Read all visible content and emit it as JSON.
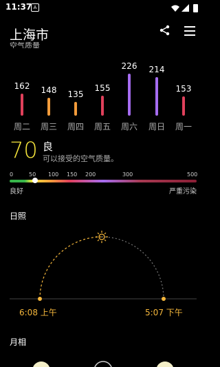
{
  "status": {
    "time": "11:37",
    "notif_icon": "A"
  },
  "header": {
    "city": "上海市",
    "aqi_section": "空气质量"
  },
  "aqi_days": [
    {
      "day": "周二",
      "value": 162,
      "color": "#e0405b"
    },
    {
      "day": "周三",
      "value": 148,
      "color": "#f29b3b"
    },
    {
      "day": "周四",
      "value": 135,
      "color": "#f29b3b"
    },
    {
      "day": "周五",
      "value": 155,
      "color": "#e0405b"
    },
    {
      "day": "周六",
      "value": 226,
      "color": "#a56cf0"
    },
    {
      "day": "周日",
      "value": 214,
      "color": "#a56cf0"
    },
    {
      "day": "周一",
      "value": 153,
      "color": "#e0405b"
    }
  ],
  "current": {
    "aqi": "70",
    "grade": "良",
    "desc": "可以接受的空气质量。"
  },
  "scale": {
    "labels": [
      "0",
      "50",
      "100",
      "150",
      "200",
      "300",
      "500"
    ],
    "good": "良好",
    "bad": "严重污染",
    "marker_value": 70
  },
  "sun": {
    "title": "日照",
    "sunrise": "6:08 上午",
    "sunset": "5:07 下午"
  },
  "moon": {
    "title": "月相"
  }
}
